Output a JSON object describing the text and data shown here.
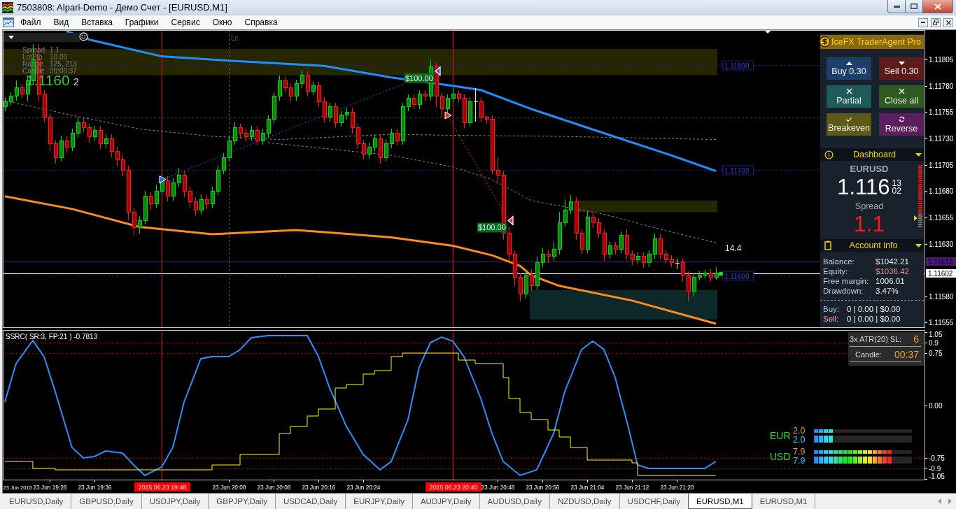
{
  "window": {
    "title": "7503808: Alpari-Demo - Демо Счет - [EURUSD,M1]"
  },
  "menu": {
    "items": [
      "Файл",
      "Вид",
      "Вставка",
      "Графики",
      "Сервис",
      "Окно",
      "Справка"
    ]
  },
  "chart": {
    "info_panel": {
      "rows": [
        {
          "label": "Spread",
          "value": "1.1"
        },
        {
          "label": "LotPip",
          "value": "10.00"
        },
        {
          "label": "Range",
          "value": "125, 213"
        },
        {
          "label": "Candle",
          "value": "00:00:37"
        }
      ],
      "price": "1.1160",
      "price_digit": "2"
    },
    "chart_data": [
      {
        "type": "candlestick",
        "tick_labels": "y",
        "x": [
          "2015-06-23T19:20",
          "2015-06-23T19:21",
          "2015-06-23T19:22",
          "2015-06-23T19:23",
          "2015-06-23T19:24",
          "2015-06-23T19:25",
          "2015-06-23T19:26",
          "2015-06-23T19:27",
          "2015-06-23T19:28",
          "2015-06-23T19:29",
          "2015-06-23T19:30",
          "2015-06-23T19:31",
          "2015-06-23T19:32",
          "2015-06-23T19:33",
          "2015-06-23T19:34",
          "2015-06-23T19:35",
          "2015-06-23T19:36",
          "2015-06-23T19:37",
          "2015-06-23T19:38",
          "2015-06-23T19:39",
          "2015-06-23T19:40",
          "2015-06-23T19:41",
          "2015-06-23T19:42",
          "2015-06-23T19:43",
          "2015-06-23T19:44",
          "2015-06-23T19:45",
          "2015-06-23T19:46",
          "2015-06-23T19:47",
          "2015-06-23T19:48",
          "2015-06-23T19:49",
          "2015-06-23T19:50",
          "2015-06-23T19:51",
          "2015-06-23T19:52",
          "2015-06-23T19:53",
          "2015-06-23T19:54",
          "2015-06-23T19:55",
          "2015-06-23T19:56",
          "2015-06-23T19:57",
          "2015-06-23T19:58",
          "2015-06-23T19:59",
          "2015-06-23T20:00",
          "2015-06-23T20:01",
          "2015-06-23T20:02",
          "2015-06-23T20:03",
          "2015-06-23T20:04",
          "2015-06-23T20:05",
          "2015-06-23T20:06",
          "2015-06-23T20:07",
          "2015-06-23T20:08",
          "2015-06-23T20:09",
          "2015-06-23T20:10",
          "2015-06-23T20:11",
          "2015-06-23T20:12",
          "2015-06-23T20:13",
          "2015-06-23T20:14",
          "2015-06-23T20:15",
          "2015-06-23T20:16",
          "2015-06-23T20:17",
          "2015-06-23T20:18",
          "2015-06-23T20:19",
          "2015-06-23T20:20",
          "2015-06-23T20:21",
          "2015-06-23T20:22",
          "2015-06-23T20:23",
          "2015-06-23T20:24",
          "2015-06-23T20:25",
          "2015-06-23T20:26",
          "2015-06-23T20:27",
          "2015-06-23T20:28",
          "2015-06-23T20:29",
          "2015-06-23T20:30",
          "2015-06-23T20:31",
          "2015-06-23T20:32",
          "2015-06-23T20:33",
          "2015-06-23T20:34",
          "2015-06-23T20:35",
          "2015-06-23T20:36",
          "2015-06-23T20:37",
          "2015-06-23T20:38",
          "2015-06-23T20:39",
          "2015-06-23T20:40",
          "2015-06-23T20:41",
          "2015-06-23T20:42",
          "2015-06-23T20:43",
          "2015-06-23T20:44",
          "2015-06-23T20:45",
          "2015-06-23T20:46",
          "2015-06-23T20:47",
          "2015-06-23T20:48",
          "2015-06-23T20:49",
          "2015-06-23T20:50",
          "2015-06-23T20:51",
          "2015-06-23T20:52",
          "2015-06-23T20:53",
          "2015-06-23T20:54",
          "2015-06-23T20:55",
          "2015-06-23T20:56",
          "2015-06-23T20:57",
          "2015-06-23T20:58",
          "2015-06-23T20:59",
          "2015-06-23T21:00",
          "2015-06-23T21:01",
          "2015-06-23T21:02",
          "2015-06-23T21:03",
          "2015-06-23T21:04",
          "2015-06-23T21:05",
          "2015-06-23T21:06",
          "2015-06-23T21:07",
          "2015-06-23T21:08",
          "2015-06-23T21:09",
          "2015-06-23T21:10",
          "2015-06-23T21:11",
          "2015-06-23T21:12",
          "2015-06-23T21:13",
          "2015-06-23T21:14",
          "2015-06-23T21:15",
          "2015-06-23T21:16",
          "2015-06-23T21:17",
          "2015-06-23T21:18",
          "2015-06-23T21:19",
          "2015-06-23T21:20",
          "2015-06-23T21:21",
          "2015-06-23T21:22",
          "2015-06-23T21:23",
          "2015-06-23T21:24",
          "2015-06-23T21:25",
          "2015-06-23T21:26",
          "2015-06-23T21:27"
        ],
        "xlim": [
          "2015-06-23T19:19:38",
          "2015-06-23T22:04:22"
        ],
        "ylim": [
          1.1155,
          1.11833
        ],
        "yticks": [
          1.11805,
          {
            "value": 1.1178,
            "label": "1.11780"
          },
          1.11755,
          {
            "value": 1.1173,
            "label": "1.11730"
          },
          1.11705,
          {
            "value": 1.1168,
            "label": "1.11680"
          },
          1.11655,
          {
            "value": 1.1163,
            "label": "1.11630"
          },
          {
            "value": 1.1158,
            "label": "1.11580"
          },
          1.11555
        ],
        "ohlc": [
          [
            1.1176,
            1.11769,
            1.11756,
            1.11765
          ],
          [
            1.11765,
            1.11774,
            1.11761,
            1.1177
          ],
          [
            1.1177,
            1.11785,
            1.11766,
            1.11778
          ],
          [
            1.11778,
            1.11782,
            1.11768,
            1.11772
          ],
          [
            1.11772,
            1.1179,
            1.11765,
            1.11785
          ],
          [
            1.11785,
            1.1182,
            1.11781,
            1.11805
          ],
          [
            1.11805,
            1.1182,
            1.11765,
            1.11772
          ],
          [
            1.11772,
            1.11776,
            1.11745,
            1.1175
          ],
          [
            1.1175,
            1.11754,
            1.11718,
            1.11725
          ],
          [
            1.11725,
            1.11729,
            1.11706,
            1.11712
          ],
          [
            1.11712,
            1.11733,
            1.11708,
            1.11728
          ],
          [
            1.11728,
            1.11732,
            1.11716,
            1.11722
          ],
          [
            1.11722,
            1.11739,
            1.11718,
            1.11735
          ],
          [
            1.11735,
            1.1175,
            1.11731,
            1.11745
          ],
          [
            1.11745,
            1.11749,
            1.11736,
            1.1174
          ],
          [
            1.1174,
            1.11744,
            1.11726,
            1.11732
          ],
          [
            1.11732,
            1.11742,
            1.11728,
            1.11738
          ],
          [
            1.11738,
            1.11742,
            1.1172,
            1.11725
          ],
          [
            1.11725,
            1.11734,
            1.11721,
            1.1173
          ],
          [
            1.1173,
            1.11734,
            1.11712,
            1.11718
          ],
          [
            1.11718,
            1.11722,
            1.11704,
            1.1171
          ],
          [
            1.1171,
            1.11714,
            1.11694,
            1.117
          ],
          [
            1.117,
            1.11704,
            1.11652,
            1.1166
          ],
          [
            1.1166,
            1.11664,
            1.11638,
            1.11645
          ],
          [
            1.11645,
            1.11656,
            1.1164,
            1.11652
          ],
          [
            1.11652,
            1.1168,
            1.11648,
            1.11675
          ],
          [
            1.11675,
            1.11679,
            1.11662,
            1.11668
          ],
          [
            1.11668,
            1.11686,
            1.11664,
            1.1168
          ],
          [
            1.1168,
            1.11696,
            1.11676,
            1.1169
          ],
          [
            1.1169,
            1.11694,
            1.1167,
            1.11675
          ],
          [
            1.11675,
            1.11692,
            1.11671,
            1.11688
          ],
          [
            1.11688,
            1.11702,
            1.11684,
            1.11695
          ],
          [
            1.11695,
            1.11699,
            1.11674,
            1.1168
          ],
          [
            1.1168,
            1.11684,
            1.11664,
            1.1167
          ],
          [
            1.1167,
            1.11674,
            1.11656,
            1.11662
          ],
          [
            1.11662,
            1.11677,
            1.11658,
            1.11672
          ],
          [
            1.11672,
            1.11676,
            1.11663,
            1.11668
          ],
          [
            1.11668,
            1.11684,
            1.11664,
            1.1168
          ],
          [
            1.1168,
            1.11704,
            1.11676,
            1.117
          ],
          [
            1.117,
            1.11716,
            1.11696,
            1.11712
          ],
          [
            1.11712,
            1.11732,
            1.11708,
            1.11728
          ],
          [
            1.11728,
            1.11745,
            1.11724,
            1.1174
          ],
          [
            1.1174,
            1.11744,
            1.1173,
            1.11735
          ],
          [
            1.11735,
            1.11739,
            1.11727,
            1.11732
          ],
          [
            1.11732,
            1.11742,
            1.11728,
            1.11738
          ],
          [
            1.11738,
            1.11742,
            1.11724,
            1.11728
          ],
          [
            1.11728,
            1.11739,
            1.11724,
            1.11735
          ],
          [
            1.11735,
            1.11752,
            1.11731,
            1.11748
          ],
          [
            1.11748,
            1.11774,
            1.11744,
            1.1177
          ],
          [
            1.1177,
            1.1179,
            1.11766,
            1.11785
          ],
          [
            1.11785,
            1.11789,
            1.11774,
            1.11778
          ],
          [
            1.11778,
            1.11782,
            1.11765,
            1.1177
          ],
          [
            1.1177,
            1.11786,
            1.11766,
            1.11782
          ],
          [
            1.11782,
            1.11795,
            1.11778,
            1.1179
          ],
          [
            1.1179,
            1.11794,
            1.1177,
            1.11775
          ],
          [
            1.11775,
            1.11784,
            1.11771,
            1.1178
          ],
          [
            1.1178,
            1.11784,
            1.1176,
            1.11765
          ],
          [
            1.11765,
            1.11769,
            1.11745,
            1.1175
          ],
          [
            1.1175,
            1.11764,
            1.11746,
            1.1176
          ],
          [
            1.1176,
            1.11764,
            1.1174,
            1.11745
          ],
          [
            1.11745,
            1.11756,
            1.11741,
            1.11752
          ],
          [
            1.11752,
            1.11759,
            1.11748,
            1.11755
          ],
          [
            1.11755,
            1.11759,
            1.11735,
            1.1174
          ],
          [
            1.1174,
            1.11744,
            1.1172,
            1.11725
          ],
          [
            1.11725,
            1.11729,
            1.1171,
            1.11715
          ],
          [
            1.11715,
            1.11726,
            1.11711,
            1.11722
          ],
          [
            1.11722,
            1.11734,
            1.11718,
            1.1173
          ],
          [
            1.1173,
            1.11734,
            1.11706,
            1.11712
          ],
          [
            1.11712,
            1.11729,
            1.11708,
            1.11725
          ],
          [
            1.11725,
            1.11739,
            1.11721,
            1.11735
          ],
          [
            1.11735,
            1.11739,
            1.11724,
            1.11728
          ],
          [
            1.11728,
            1.11764,
            1.11724,
            1.1176
          ],
          [
            1.1176,
            1.11772,
            1.11756,
            1.11768
          ],
          [
            1.11768,
            1.11772,
            1.11758,
            1.11762
          ],
          [
            1.11762,
            1.11776,
            1.11758,
            1.11772
          ],
          [
            1.11772,
            1.11776,
            1.11766,
            1.1177
          ],
          [
            1.1177,
            1.11805,
            1.11766,
            1.11798
          ],
          [
            1.11798,
            1.11802,
            1.1176,
            1.1177
          ],
          [
            1.1177,
            1.11774,
            1.1175,
            1.11758
          ],
          [
            1.11758,
            1.11772,
            1.11754,
            1.11768
          ],
          [
            1.11768,
            1.11778,
            1.11764,
            1.11772
          ],
          [
            1.11772,
            1.11776,
            1.11764,
            1.11768
          ],
          [
            1.11768,
            1.11772,
            1.1174,
            1.11745
          ],
          [
            1.11745,
            1.11769,
            1.11741,
            1.11765
          ],
          [
            1.11765,
            1.11778,
            1.11746,
            1.11765
          ],
          [
            1.11765,
            1.11769,
            1.11746,
            1.1175
          ],
          [
            1.1175,
            1.11752,
            1.11744,
            1.11748
          ],
          [
            1.11748,
            1.11752,
            1.11696,
            1.117
          ],
          [
            1.117,
            1.11712,
            1.11688,
            1.11695
          ],
          [
            1.11695,
            1.11699,
            1.11634,
            1.1164
          ],
          [
            1.1164,
            1.11646,
            1.11614,
            1.1162
          ],
          [
            1.1162,
            1.11624,
            1.1159,
            1.11598
          ],
          [
            1.11598,
            1.11602,
            1.11575,
            1.11582
          ],
          [
            1.11582,
            1.11605,
            1.11578,
            1.116
          ],
          [
            1.116,
            1.11606,
            1.11585,
            1.1159
          ],
          [
            1.1159,
            1.11618,
            1.11586,
            1.11612
          ],
          [
            1.11612,
            1.11626,
            1.11608,
            1.1162
          ],
          [
            1.1162,
            1.11624,
            1.11612,
            1.11618
          ],
          [
            1.11618,
            1.11632,
            1.11614,
            1.11625
          ],
          [
            1.11625,
            1.1166,
            1.1162,
            1.1165
          ],
          [
            1.1165,
            1.11672,
            1.11646,
            1.11662
          ],
          [
            1.11662,
            1.11676,
            1.11658,
            1.1167
          ],
          [
            1.1167,
            1.11674,
            1.11634,
            1.1164
          ],
          [
            1.1164,
            1.11644,
            1.1162,
            1.11625
          ],
          [
            1.11625,
            1.1166,
            1.11621,
            1.11655
          ],
          [
            1.11655,
            1.11659,
            1.11645,
            1.1165
          ],
          [
            1.1165,
            1.11654,
            1.11635,
            1.1164
          ],
          [
            1.1164,
            1.11644,
            1.11614,
            1.1162
          ],
          [
            1.1162,
            1.11632,
            1.11616,
            1.11628
          ],
          [
            1.11628,
            1.11632,
            1.1162,
            1.11625
          ],
          [
            1.11625,
            1.11642,
            1.11621,
            1.11638
          ],
          [
            1.11638,
            1.11644,
            1.11615,
            1.1162
          ],
          [
            1.1162,
            1.11624,
            1.1161,
            1.11615
          ],
          [
            1.11615,
            1.11622,
            1.11611,
            1.11618
          ],
          [
            1.11618,
            1.11622,
            1.11607,
            1.11612
          ],
          [
            1.11612,
            1.11624,
            1.11608,
            1.1162
          ],
          [
            1.1162,
            1.1164,
            1.11616,
            1.11635
          ],
          [
            1.11635,
            1.11639,
            1.11615,
            1.1162
          ],
          [
            1.1162,
            1.11624,
            1.11611,
            1.11615
          ],
          [
            1.11615,
            1.11619,
            1.11608,
            1.11612
          ],
          [
            1.11612,
            1.11616,
            1.11606,
            1.11612
          ],
          [
            1.11612,
            1.11616,
            1.11594,
            1.116
          ],
          [
            1.116,
            1.11604,
            1.11575,
            1.11585
          ],
          [
            1.11585,
            1.11602,
            1.1158,
            1.11598
          ],
          [
            1.11598,
            1.11604,
            1.11595,
            1.116
          ],
          [
            1.116,
            1.11605,
            1.11597,
            1.11602
          ],
          [
            1.11602,
            1.11606,
            1.11594,
            1.11598
          ],
          [
            1.11598,
            1.11608,
            1.11596,
            1.11602
          ]
        ],
        "series": [
          {
            "type": "line",
            "color": "#1e8fff",
            "line_style": "solid",
            "x": [
              "2015-06-23T19:31",
              "2015-06-23T19:35",
              "2015-06-23T19:48",
              "2015-06-23T20:00",
              "2015-06-23T20:17",
              "2015-06-23T20:29",
              "2015-06-23T20:40",
              "2015-06-23T20:45",
              "2015-06-23T20:54",
              "2015-06-23T21:07",
              "2015-06-23T21:19",
              "2015-06-23T21:27"
            ],
            "values": [
              1.11832,
              1.11824,
              1.11808,
              1.11804,
              1.11799,
              1.11788,
              1.1178,
              1.11776,
              1.11758,
              1.11735,
              1.11714,
              1.11699
            ]
          },
          {
            "type": "line",
            "color": "#ff8c1a",
            "line_style": "solid",
            "x": [
              "2015-06-23T19:20",
              "2015-06-23T19:32",
              "2015-06-23T19:44",
              "2015-06-23T19:57",
              "2015-06-23T20:12",
              "2015-06-23T20:22",
              "2015-06-23T20:29",
              "2015-06-23T20:40",
              "2015-06-23T20:47",
              "2015-06-23T20:52",
              "2015-06-23T20:54",
              "2015-06-23T20:59",
              "2015-06-23T21:12",
              "2015-06-23T21:27"
            ],
            "values": [
              1.11675,
              1.11663,
              1.11646,
              1.11639,
              1.11643,
              1.11639,
              1.11636,
              1.11628,
              1.11619,
              1.11609,
              1.116,
              1.1159,
              1.11576,
              1.11554
            ]
          },
          {
            "type": "line",
            "color": "#8c8c8c",
            "line_style": "dashed",
            "x": [
              "2015-06-23T19:20",
              "2015-06-23T19:32",
              "2015-06-23T19:44",
              "2015-06-23T19:57",
              "2015-06-23T20:09",
              "2015-06-23T20:29",
              "2015-06-23T20:40",
              "2015-06-23T20:59",
              "2015-06-23T21:27"
            ],
            "values": [
              1.11766,
              1.11752,
              1.11739,
              1.11732,
              1.11729,
              1.11734,
              1.11733,
              1.11732,
              1.11729
            ]
          },
          {
            "type": "line",
            "color": "#8c8c8c",
            "line_style": "dashed",
            "x": [
              "2015-06-23T20:07",
              "2015-06-23T20:29",
              "2015-06-23T20:40",
              "2015-06-23T20:47",
              "2015-06-23T20:54",
              "2015-06-23T21:07",
              "2015-06-23T21:19",
              "2015-06-23T21:27"
            ],
            "values": [
              1.11726,
              1.11714,
              1.11703,
              1.11691,
              1.11671,
              1.11658,
              1.11641,
              1.11631
            ]
          },
          {
            "type": "line",
            "color": "#2f5bff",
            "line_style": "dotted",
            "marker": "triangle",
            "x": [
              "2015-06-23T19:48",
              "2015-06-23T20:37"
            ],
            "values": [
              1.11691,
              1.11794
            ]
          },
          {
            "type": "line",
            "color": "#ff2a2a",
            "line_style": "dotted",
            "marker": "triangle",
            "x": [
              "2015-06-23T20:39",
              "2015-06-23T20:50"
            ],
            "values": [
              1.11752,
              1.11652
            ]
          }
        ],
        "bands": [
          {
            "axis": "y",
            "from": 1.1179,
            "to": 1.11815,
            "color": "#262600"
          },
          {
            "axis": "y",
            "from": 1.1166,
            "to": 1.11671,
            "color": "#262600"
          },
          {
            "axis": "y",
            "from": 1.11558,
            "to": 1.11586,
            "color": "#0c2828"
          }
        ],
        "ref_lines": [
          {
            "axis": "y",
            "value": 1.118,
            "label": "1.11800",
            "color": "#1c1c8c",
            "line_style": "dashed"
          },
          {
            "axis": "y",
            "value": 1.117,
            "label": "1.11700",
            "color": "#1c1c8c",
            "line_style": "dashed"
          },
          {
            "axis": "y",
            "value": 1.116,
            "label": "1.11600",
            "color": "#1c1c8c",
            "line_style": "dashed"
          },
          {
            "axis": "y",
            "value": 1.1175,
            "color": "#4a3f30",
            "line_style": "dashed"
          },
          {
            "axis": "y",
            "value": 1.11613,
            "label": "1.11613",
            "color": "#4b1a78",
            "line_style": "solid"
          },
          {
            "axis": "y",
            "value": 1.11602,
            "label": "1.11602",
            "color": "#ffffff",
            "line_style": "solid"
          },
          {
            "axis": "x",
            "value": "2015-06-23T19:48",
            "color": "#ff0000",
            "line_style": "solid"
          },
          {
            "axis": "x",
            "value": "2015-06-23T20:40",
            "color": "#ff0000",
            "line_style": "solid"
          },
          {
            "axis": "x",
            "value": "2015-06-23T20:00",
            "label": "Lc",
            "color": "#6b6b00",
            "line_style": "dashed"
          }
        ],
        "annotations": [
          "$100.00",
          "$100.00",
          "14.4"
        ]
      }
    ]
  },
  "trade_panel": {
    "title": "IceFX TraderAgent Pro",
    "buttons": [
      {
        "kind": "buy",
        "label": "Buy 0.30"
      },
      {
        "kind": "sell",
        "label": "Sell 0.30"
      },
      {
        "kind": "partial",
        "label": "Partial"
      },
      {
        "kind": "closeall",
        "label": "Close all"
      },
      {
        "kind": "breakeven",
        "label": "Breakeven"
      },
      {
        "kind": "reverse",
        "label": "Reverse"
      }
    ],
    "dashboard": {
      "title": "Dashboard",
      "symbol": "EURUSD",
      "price": "1.116",
      "ask_digits": "13",
      "bid_digits": "02",
      "spread_label": "Spread",
      "spread": "1.1",
      "meter": {
        "level": 0.78
      }
    },
    "account": {
      "title": "Account info",
      "rows": [
        {
          "label": "Balance:",
          "value": "$1042.21",
          "negative": false
        },
        {
          "label": "Equity:",
          "value": "$1036.42",
          "negative": true
        },
        {
          "label": "Free margin:",
          "value": "1006.01",
          "negative": false
        },
        {
          "label": "Drawdown:",
          "value": "3.47%",
          "negative": false
        }
      ],
      "positions": [
        {
          "kind": "buy",
          "label": "Buy:",
          "value": "0 | 0.00 | $0.00"
        },
        {
          "kind": "sell",
          "label": "Sell:",
          "value": "0 | 0.00 | $0.00"
        }
      ]
    }
  },
  "indicator": {
    "atr": [
      {
        "label": "3x ATR(20) SL:",
        "value": "6"
      },
      {
        "label": "Candle:",
        "value": "00:37"
      }
    ],
    "strength": [
      {
        "currency": "EUR",
        "rows": [
          {
            "value": "2.0",
            "level": 0.2
          },
          {
            "value": "2.0",
            "level": 0.2
          }
        ]
      },
      {
        "currency": "USD",
        "rows": [
          {
            "value": "7.9",
            "level": 0.79
          },
          {
            "value": "7.9",
            "level": 0.79
          }
        ]
      }
    ],
    "chart_data": [
      {
        "type": "line",
        "title": "SSRC( SR:3, FP:21 ) -0.7813",
        "xlim": [
          "2015-06-23T19:19:38",
          "2015-06-23T22:04:22"
        ],
        "ylim": [
          -1.07,
          1.08
        ],
        "xticks": [
          {
            "value": "2015-06-23T19:28",
            "label": "23 Jun 19:28"
          },
          {
            "value": "2015-06-23T19:36",
            "label": "23 Jun 19:36"
          },
          {
            "value": "2015-06-23T20:00",
            "label": "23 Jun 20:00"
          },
          {
            "value": "2015-06-23T20:08",
            "label": "23 Jun 20:08"
          },
          {
            "value": "2015-06-23T20:16",
            "label": "23 Jun 20:16"
          },
          {
            "value": "2015-06-23T20:24",
            "label": "23 Jun 20:24"
          },
          {
            "value": "2015-06-23T20:48",
            "label": "23 Jun 20:48"
          },
          {
            "value": "2015-06-23T20:56",
            "label": "23 Jun 20:56"
          },
          {
            "value": "2015-06-23T21:04",
            "label": "23 Jun 21:04"
          },
          {
            "value": "2015-06-23T21:12",
            "label": "23 Jun 21:12"
          },
          {
            "value": "2015-06-23T21:20",
            "label": "23 Jun 21:20"
          }
        ],
        "yticks": [
          1.05,
          0.9,
          0.75,
          {
            "value": 0,
            "label": "0.00"
          },
          -0.75,
          -0.9,
          -1.05
        ],
        "ref_lines": [
          {
            "axis": "y",
            "value": 0.9,
            "color": "#a00000",
            "line_style": "dashed"
          },
          {
            "axis": "y",
            "value": 0.75,
            "color": "#a00000",
            "line_style": "dashed"
          },
          {
            "axis": "y",
            "value": -0.75,
            "color": "#a00000",
            "line_style": "dashed"
          },
          {
            "axis": "y",
            "value": -0.9,
            "color": "#a00000",
            "line_style": "dashed"
          },
          {
            "axis": "x",
            "value": "2015-06-23T19:48",
            "label": "2015.06.23 19:48",
            "color": "#ff0000",
            "line_style": "solid"
          },
          {
            "axis": "x",
            "value": "2015-06-23T20:40",
            "label": "2015.06.23 20:40",
            "color": "#ff0000",
            "line_style": "solid"
          }
        ],
        "series": [
          {
            "type": "line",
            "color": "#2e8fff",
            "x": [
              "2015-06-23T19:20",
              "2015-06-23T19:22",
              "2015-06-23T19:25",
              "2015-06-23T19:27",
              "2015-06-23T19:29",
              "2015-06-23T19:32",
              "2015-06-23T19:34",
              "2015-06-23T19:36",
              "2015-06-23T19:38",
              "2015-06-23T19:41",
              "2015-06-23T19:43",
              "2015-06-23T19:45",
              "2015-06-23T19:48",
              "2015-06-23T19:50",
              "2015-06-23T19:52",
              "2015-06-23T19:55",
              "2015-06-23T19:57",
              "2015-06-23T20:00",
              "2015-06-23T20:02",
              "2015-06-23T20:04",
              "2015-06-23T20:07",
              "2015-06-23T20:14",
              "2015-06-23T20:16",
              "2015-06-23T20:18",
              "2015-06-23T20:21",
              "2015-06-23T20:24",
              "2015-06-23T20:27",
              "2015-06-23T20:29",
              "2015-06-23T20:32",
              "2015-06-23T20:34",
              "2015-06-23T20:36",
              "2015-06-23T20:38",
              "2015-06-23T20:40",
              "2015-06-23T20:42",
              "2015-06-23T20:45",
              "2015-06-23T20:47",
              "2015-06-23T20:49",
              "2015-06-23T20:52",
              "2015-06-23T20:55",
              "2015-06-23T20:58",
              "2015-06-23T21:00",
              "2015-06-23T21:03",
              "2015-06-23T21:05",
              "2015-06-23T21:07",
              "2015-06-23T21:09",
              "2015-06-23T21:11",
              "2015-06-23T21:13",
              "2015-06-23T21:15",
              "2015-06-23T21:25",
              "2015-06-23T21:27"
            ],
            "values": [
              0.05,
              0.6,
              0.93,
              0.7,
              0.2,
              -0.6,
              -0.75,
              -0.73,
              -0.65,
              -0.68,
              -0.85,
              -1,
              -0.88,
              -0.6,
              0.05,
              0.67,
              0.7,
              0.7,
              0.8,
              0.97,
              1,
              1,
              0.7,
              0.25,
              -0.3,
              -0.7,
              -0.92,
              -0.8,
              -0.2,
              0.55,
              0.9,
              0.98,
              0.92,
              0.7,
              0.1,
              -0.4,
              -0.8,
              -1,
              -0.92,
              -0.4,
              0.2,
              0.8,
              0.92,
              0.8,
              0.4,
              -0.2,
              -0.85,
              -0.9,
              -0.9,
              -0.8
            ]
          },
          {
            "type": "step",
            "color": "#ffff00",
            "x": [
              "2015-06-23T19:20",
              "2015-06-23T19:24",
              "2015-06-23T19:25",
              "2015-06-23T19:29",
              "2015-06-23T19:57",
              "2015-06-23T20:02",
              "2015-06-23T20:09",
              "2015-06-23T20:11",
              "2015-06-23T20:14",
              "2015-06-23T20:16",
              "2015-06-23T20:19",
              "2015-06-23T20:21",
              "2015-06-23T20:24",
              "2015-06-23T20:26",
              "2015-06-23T20:29",
              "2015-06-23T20:31",
              "2015-06-23T20:41",
              "2015-06-23T20:44",
              "2015-06-23T20:49",
              "2015-06-23T20:50",
              "2015-06-23T20:52",
              "2015-06-23T20:54",
              "2015-06-23T20:57",
              "2015-06-23T20:59",
              "2015-06-23T21:01",
              "2015-06-23T21:04",
              "2015-06-23T21:12",
              "2015-06-23T21:13",
              "2015-06-23T21:27"
            ],
            "values": [
              -0.8,
              -0.8,
              -0.9,
              -0.92,
              -0.85,
              -0.7,
              -0.4,
              -0.3,
              -0.15,
              -0.05,
              0.25,
              0.3,
              0.45,
              0.5,
              0.7,
              0.75,
              0.65,
              0.6,
              0.4,
              0.1,
              -0.1,
              -0.2,
              -0.35,
              -0.45,
              -0.6,
              -0.78,
              -0.82,
              -1,
              -1
            ]
          }
        ],
        "annotations": [
          "23 Jun 2015"
        ]
      }
    ]
  },
  "tabs": [
    {
      "label": "EURUSD,Daily",
      "selected": false
    },
    {
      "label": "GBPUSD,Daily",
      "selected": false
    },
    {
      "label": "USDJPY,Daily",
      "selected": false
    },
    {
      "label": "GBPJPY,Daily",
      "selected": false
    },
    {
      "label": "USDCAD,Daily",
      "selected": false
    },
    {
      "label": "EURJPY,Daily",
      "selected": false
    },
    {
      "label": "AUDJPY,Daily",
      "selected": false
    },
    {
      "label": "AUDUSD,Daily",
      "selected": false
    },
    {
      "label": "NZDUSD,Daily",
      "selected": false
    },
    {
      "label": "USDCHF,Daily",
      "selected": false
    },
    {
      "label": "EURUSD,M1",
      "selected": true
    },
    {
      "label": "EURUSD,M1",
      "selected": false
    }
  ]
}
